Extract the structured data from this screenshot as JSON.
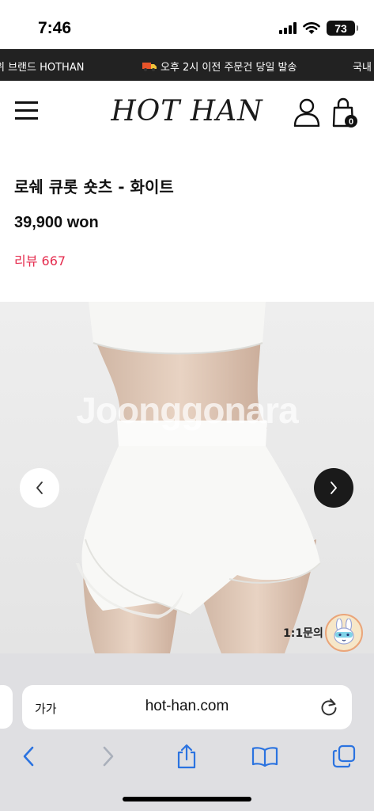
{
  "status_bar": {
    "time": "7:46",
    "battery": "73"
  },
  "announcement": {
    "left_text": "위 브랜드 HOTHAN",
    "center_text": "오후 2시 이전 주문건 당일 발송",
    "right_text": "국내"
  },
  "header": {
    "logo": "HOT HAN",
    "cart_count": "0"
  },
  "product": {
    "title": "로쉐 큐롯 숏츠 - 화이트",
    "price": "39,900 won",
    "review": "리뷰 667",
    "watermark": "Joonggonara"
  },
  "inquiry": {
    "label": "1:1문의"
  },
  "browser": {
    "aa_label": "가가",
    "url": "hot-han.com"
  },
  "colors": {
    "accent_review": "#e52c4e",
    "announcement_bg": "#222222",
    "safari_bar": "#dfdfe2",
    "safari_tint": "#2b73e0"
  }
}
